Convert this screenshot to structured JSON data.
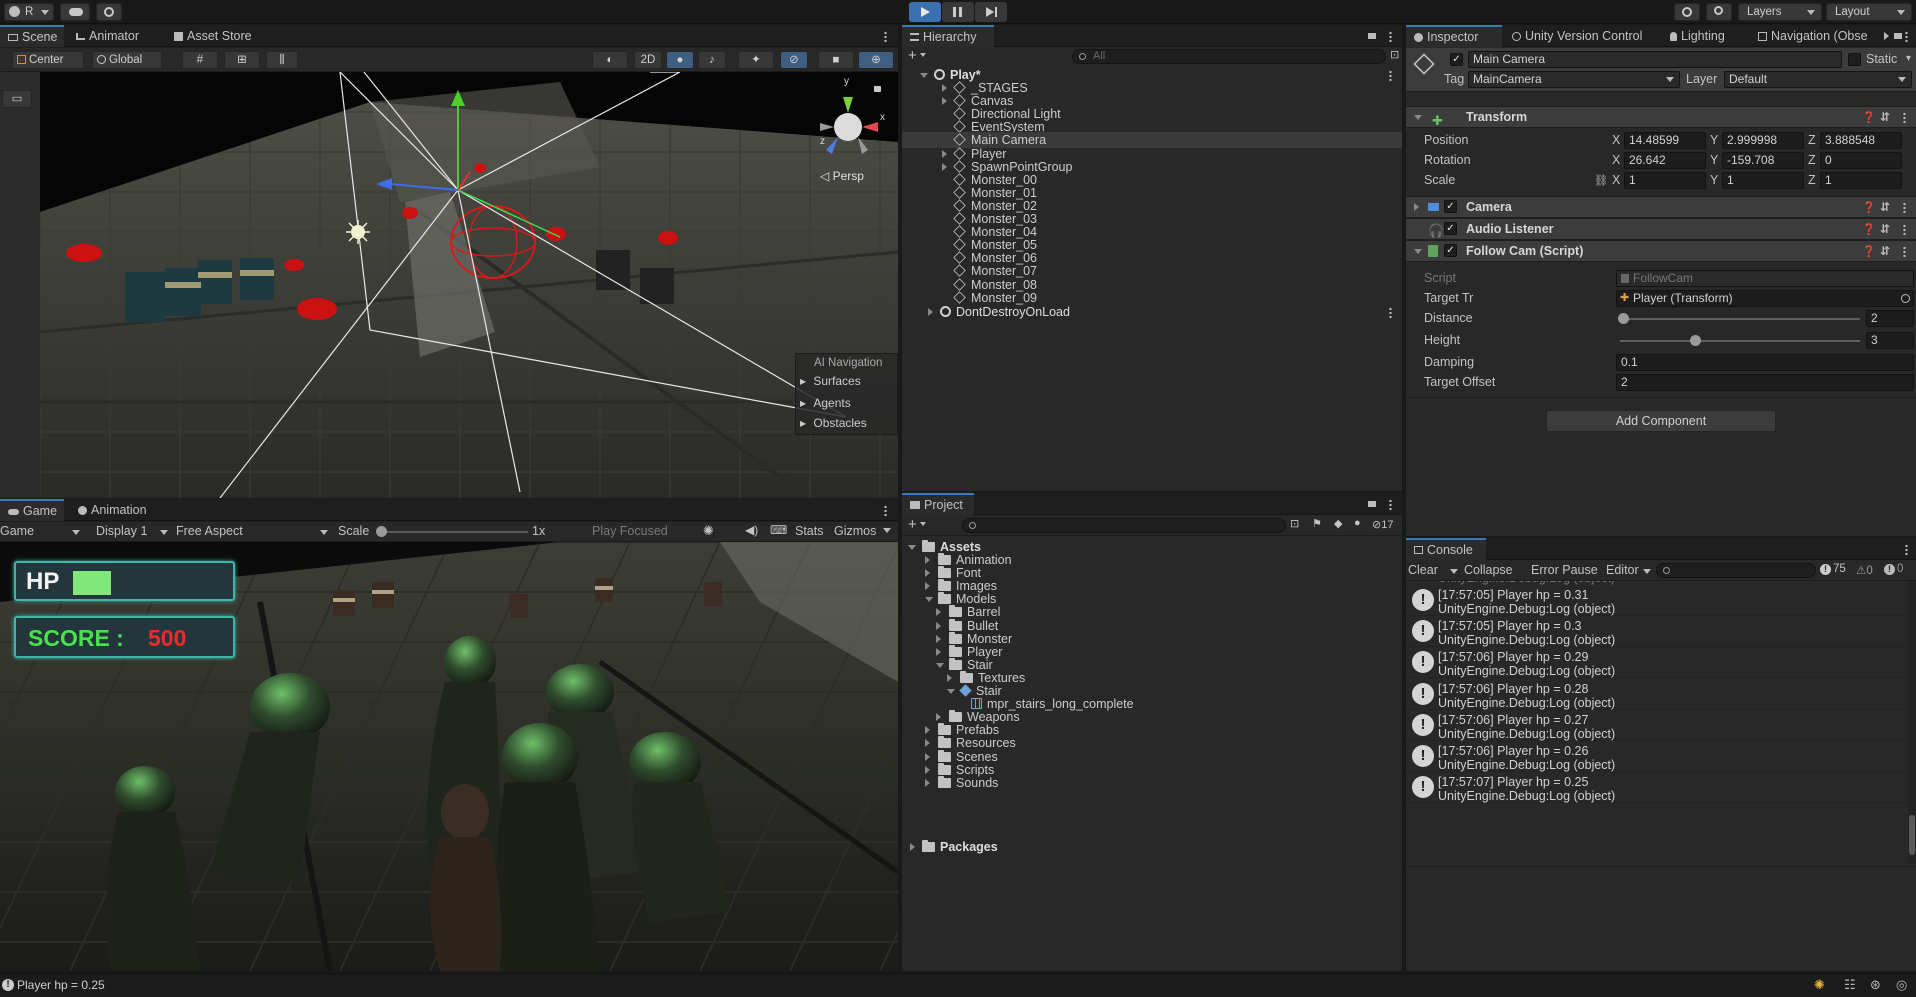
{
  "toolbar": {
    "account": "R",
    "layers_label": "Layers",
    "layout_label": "Layout"
  },
  "scene": {
    "tabs": [
      "Scene",
      "Animator",
      "Asset Store"
    ],
    "pivot": "Center",
    "space": "Global",
    "mode_2d": "2D",
    "persp": "Persp",
    "ai_nav_title": "AI Navigation",
    "ai_nav_items": [
      "Surfaces",
      "Agents",
      "Obstacles"
    ]
  },
  "game": {
    "tabs": [
      "Game",
      "Animation"
    ],
    "display_mode": "Game",
    "display": "Display 1",
    "aspect": "Free Aspect",
    "scale_label": "Scale",
    "scale_value": "1x",
    "play_focused": "Play Focused",
    "stats": "Stats",
    "gizmos": "Gizmos",
    "hp_label": "HP",
    "score_label": "SCORE :",
    "score_value": "500",
    "hp_fraction": 0.25
  },
  "hierarchy": {
    "title": "Hierarchy",
    "search_placeholder": "All",
    "root": "Play*",
    "items": [
      "_STAGES",
      "Canvas",
      "Directional Light",
      "EventSystem",
      "Main Camera",
      "Player",
      "SpawnPointGroup",
      "Monster_00",
      "Monster_01",
      "Monster_02",
      "Monster_03",
      "Monster_04",
      "Monster_05",
      "Monster_06",
      "Monster_07",
      "Monster_08",
      "Monster_09"
    ],
    "ddol": "DontDestroyOnLoad"
  },
  "project": {
    "title": "Project",
    "hidden_count": "17",
    "assets_label": "Assets",
    "packages_label": "Packages",
    "tree": [
      {
        "name": "Animation",
        "depth": 1
      },
      {
        "name": "Font",
        "depth": 1
      },
      {
        "name": "Images",
        "depth": 1
      },
      {
        "name": "Models",
        "depth": 1
      },
      {
        "name": "Barrel",
        "depth": 2
      },
      {
        "name": "Bullet",
        "depth": 2
      },
      {
        "name": "Monster",
        "depth": 2
      },
      {
        "name": "Player",
        "depth": 2
      },
      {
        "name": "Stair",
        "depth": 2
      },
      {
        "name": "Textures",
        "depth": 3
      },
      {
        "name": "Stair",
        "depth": 3
      },
      {
        "name": "mpr_stairs_long_complete",
        "depth": 4
      },
      {
        "name": "Weapons",
        "depth": 2
      },
      {
        "name": "Prefabs",
        "depth": 1
      },
      {
        "name": "Resources",
        "depth": 1
      },
      {
        "name": "Scenes",
        "depth": 1
      },
      {
        "name": "Scripts",
        "depth": 1
      },
      {
        "name": "Sounds",
        "depth": 1
      }
    ]
  },
  "inspector": {
    "tabs": [
      "Inspector",
      "Unity Version Control",
      "Lighting",
      "Navigation (Obse"
    ],
    "object_name": "Main Camera",
    "static_label": "Static",
    "tag_label": "Tag",
    "tag_value": "MainCamera",
    "layer_label": "Layer",
    "layer_value": "Default",
    "transform": {
      "title": "Transform",
      "position_label": "Position",
      "rotation_label": "Rotation",
      "scale_label": "Scale",
      "position": {
        "x": "14.48599",
        "y": "2.999998",
        "z": "3.888548"
      },
      "rotation": {
        "x": "26.642",
        "y": "-159.708",
        "z": "0"
      },
      "scale": {
        "x": "1",
        "y": "1",
        "z": "1"
      }
    },
    "camera_title": "Camera",
    "audio_title": "Audio Listener",
    "followcam": {
      "title": "Follow Cam (Script)",
      "script_label": "Script",
      "script_value": "FollowCam",
      "target_label": "Target Tr",
      "target_value": "Player (Transform)",
      "distance_label": "Distance",
      "distance_value": "2",
      "distance_fraction": 0.0,
      "height_label": "Height",
      "height_value": "3",
      "height_fraction": 0.3,
      "damping_label": "Damping",
      "damping_value": "0.1",
      "offset_label": "Target Offset",
      "offset_value": "2"
    },
    "add_component": "Add Component"
  },
  "console": {
    "title": "Console",
    "clear": "Clear",
    "collapse": "Collapse",
    "error_pause": "Error Pause",
    "editor": "Editor",
    "log_count": "75",
    "warn_count": "0",
    "error_count": "0",
    "logs": [
      {
        "line1": "[17:57:05] Player hp = 0.31",
        "line2": "UnityEngine.Debug:Log (object)"
      },
      {
        "line1": "[17:57:05] Player hp = 0.3",
        "line2": "UnityEngine.Debug:Log (object)"
      },
      {
        "line1": "[17:57:06] Player hp = 0.29",
        "line2": "UnityEngine.Debug:Log (object)"
      },
      {
        "line1": "[17:57:06] Player hp = 0.28",
        "line2": "UnityEngine.Debug:Log (object)"
      },
      {
        "line1": "[17:57:06] Player hp = 0.27",
        "line2": "UnityEngine.Debug:Log (object)"
      },
      {
        "line1": "[17:57:06] Player hp = 0.26",
        "line2": "UnityEngine.Debug:Log (object)"
      },
      {
        "line1": "[17:57:07] Player hp = 0.25",
        "line2": "UnityEngine.Debug:Log (object)"
      }
    ]
  },
  "status_bar": {
    "message": "Player hp = 0.25"
  }
}
